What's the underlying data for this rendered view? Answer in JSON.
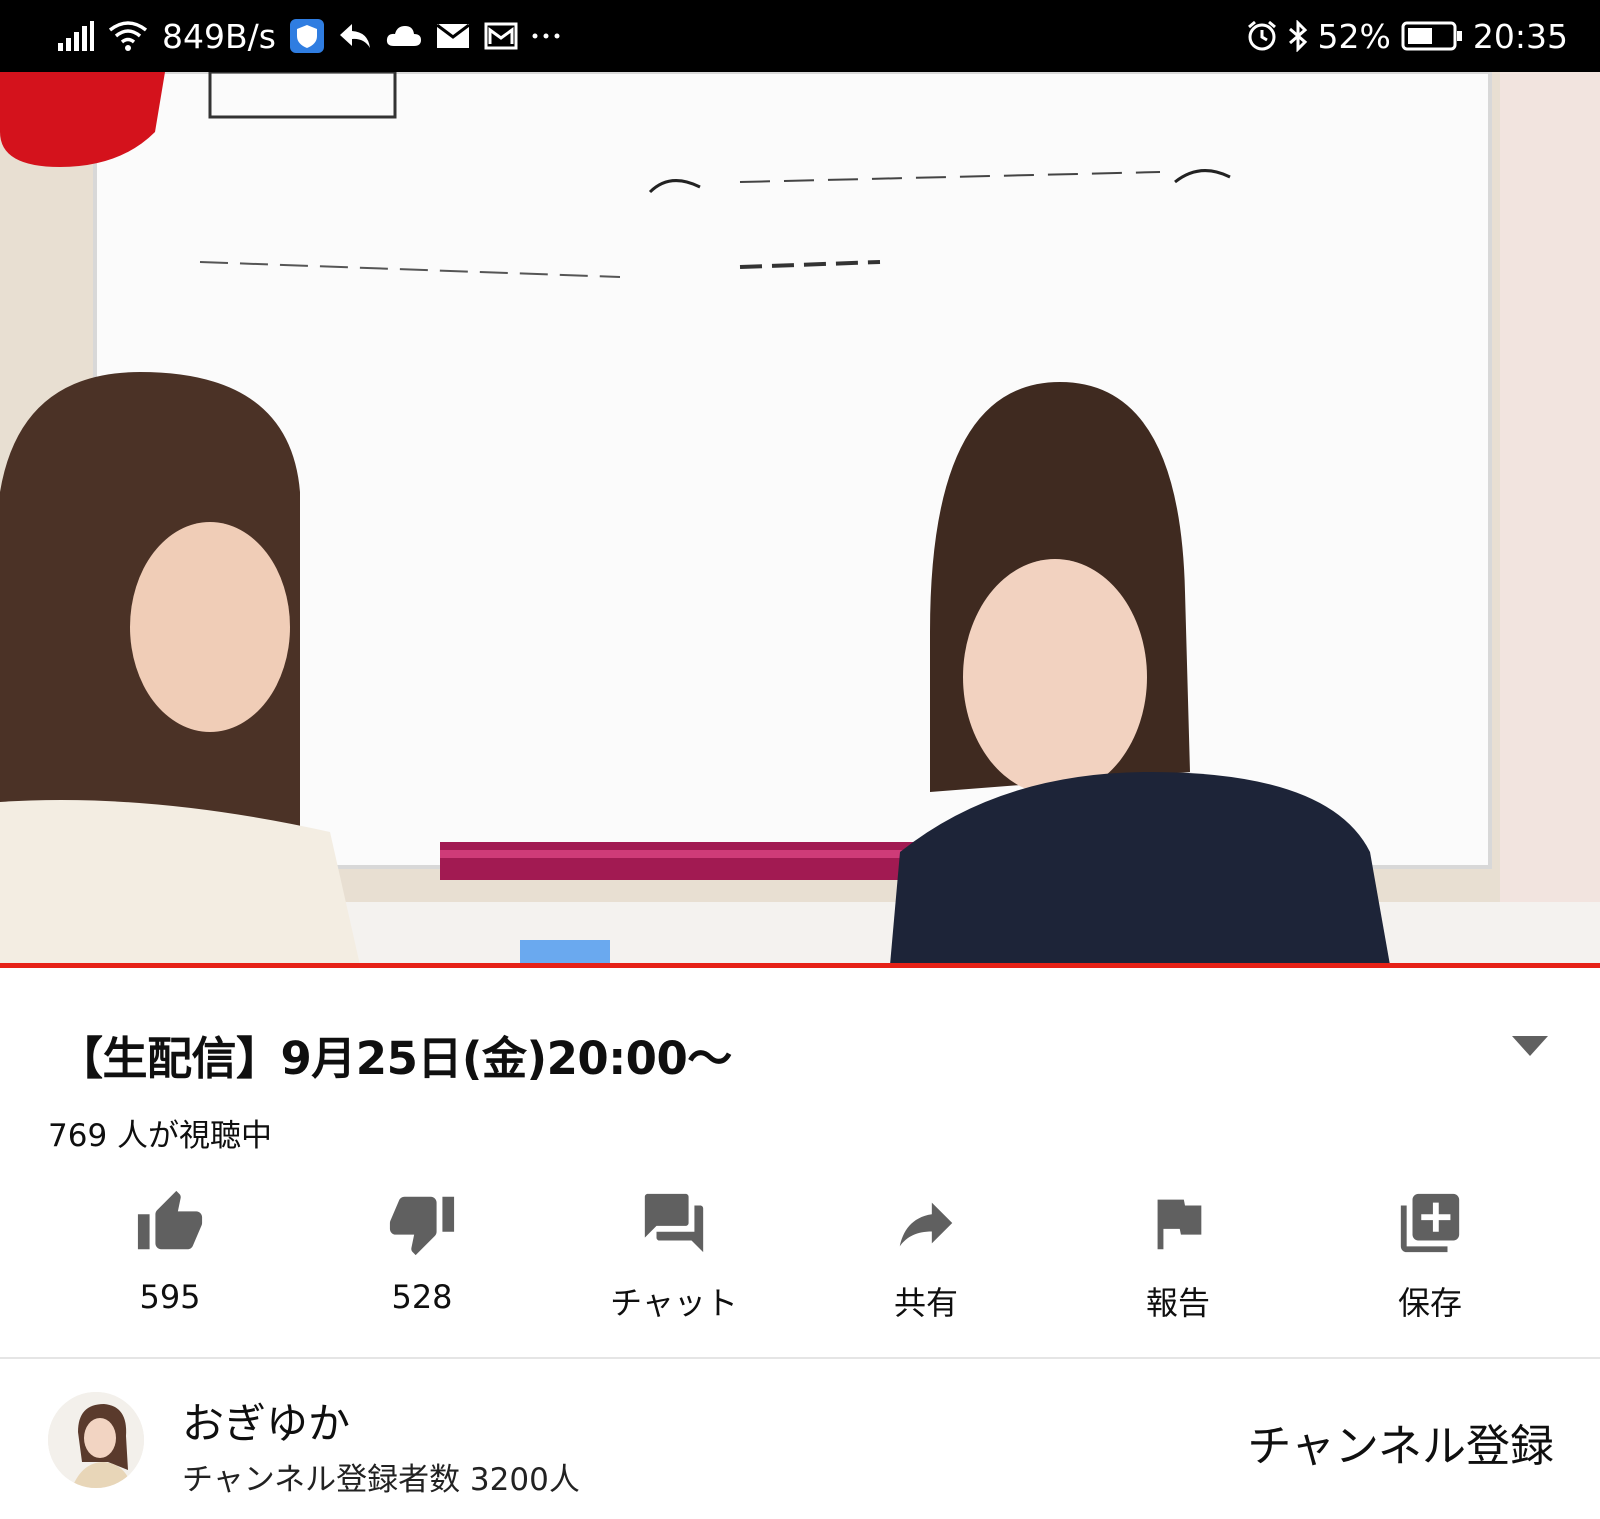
{
  "status_bar": {
    "net_speed": "849B/s",
    "battery": "52%",
    "time": "20:35",
    "icons": [
      "signal-icon",
      "wifi-icon",
      "shield-icon",
      "reply-icon",
      "cloud-icon",
      "mail-icon",
      "gmail-icon",
      "more-dots-icon",
      "alarm-icon",
      "bluetooth-icon",
      "battery-icon"
    ]
  },
  "video": {
    "progress_fraction": 1.0,
    "progress_color": "#e62117"
  },
  "video_info": {
    "title": "【生配信】9月25日(金)20:00～",
    "viewers": "769 人が視聴中"
  },
  "actions": [
    {
      "icon": "thumbs-up-icon",
      "label": "595"
    },
    {
      "icon": "thumbs-down-icon",
      "label": "528"
    },
    {
      "icon": "chat-icon",
      "label": "チャット"
    },
    {
      "icon": "share-icon",
      "label": "共有"
    },
    {
      "icon": "flag-icon",
      "label": "報告"
    },
    {
      "icon": "add-to-playlist-icon",
      "label": "保存"
    }
  ],
  "channel": {
    "name": "おぎゆか",
    "subscribers": "チャンネル登録者数 3200人",
    "subscribe_label": "チャンネル登録"
  }
}
